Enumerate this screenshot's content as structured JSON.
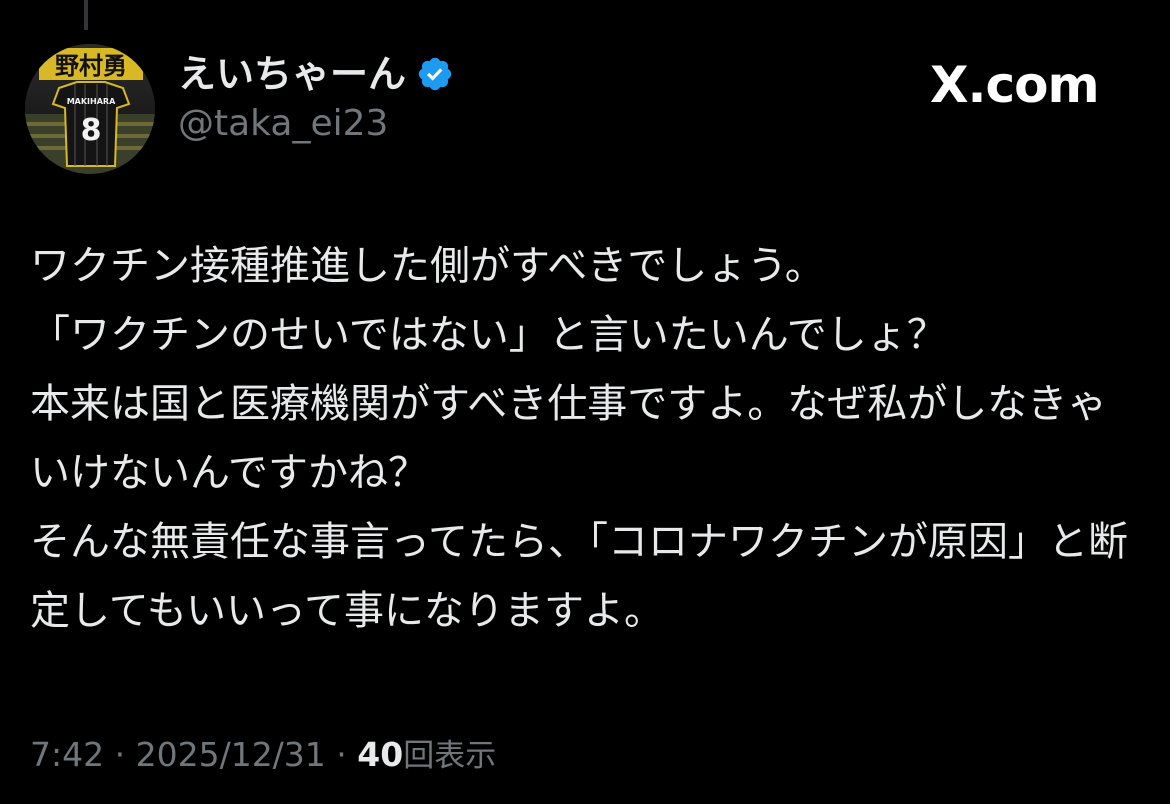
{
  "site": "X.com",
  "author": {
    "display_name": "えいちゃーん",
    "handle": "@taka_ei23",
    "verified": true,
    "avatar": {
      "banner_text": "野村勇",
      "jersey_name": "MAKIHARA",
      "jersey_number": "8"
    }
  },
  "tweet": {
    "text": "ワクチン接種推進した側がすべきでしょう。\n「ワクチンのせいではない」と言いたいんでしょ？\n本来は国と医療機関がすべき仕事ですよ。なぜ私がしなきゃいけないんですかね？\nそんな無責任な事言ってたら、「コロナワクチンが原因」と断定してもいいって事になりますよ。"
  },
  "meta": {
    "time": "7:42",
    "separator": " · ",
    "date": "2025/12/31",
    "views_count": "40",
    "views_label": "回表示"
  },
  "colors": {
    "background": "#000000",
    "text": "#e7e9ea",
    "muted": "#71767b",
    "verified": "#1d9bf0"
  },
  "icons": {
    "verified": "verified-badge-icon"
  }
}
